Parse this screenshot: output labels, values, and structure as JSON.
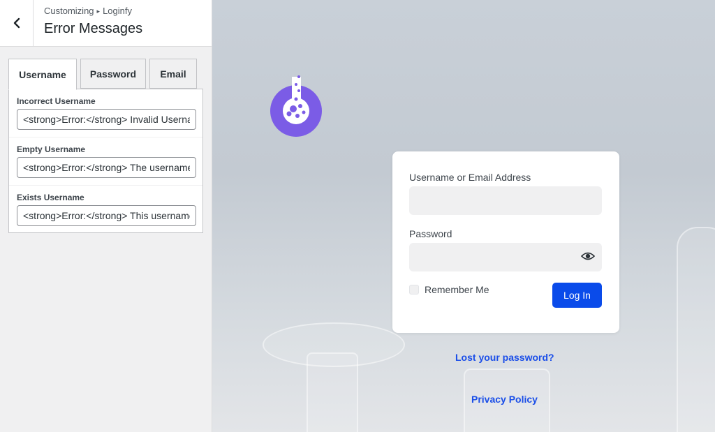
{
  "sidebar": {
    "breadcrumb": {
      "parent": "Customizing",
      "separator": "▸",
      "child": "Loginfy"
    },
    "title": "Error Messages",
    "tabs": [
      {
        "label": "Username",
        "active": true
      },
      {
        "label": "Password",
        "active": false
      },
      {
        "label": "Email",
        "active": false
      }
    ],
    "fields": [
      {
        "label": "Incorrect Username",
        "value": "<strong>Error:</strong> Invalid Username"
      },
      {
        "label": "Empty Username",
        "value": "<strong>Error:</strong> The username field is empty."
      },
      {
        "label": "Exists Username",
        "value": "<strong>Error:</strong> This username is already registered."
      }
    ]
  },
  "login": {
    "username_label": "Username or Email Address",
    "password_label": "Password",
    "remember_label": "Remember Me",
    "login_button": "Log In",
    "lost_password": "Lost your password?",
    "privacy_policy": "Privacy Policy"
  },
  "colors": {
    "accent": "#0a4bea",
    "link": "#1a4ee8",
    "logo_purple": "#7b5ce6"
  }
}
